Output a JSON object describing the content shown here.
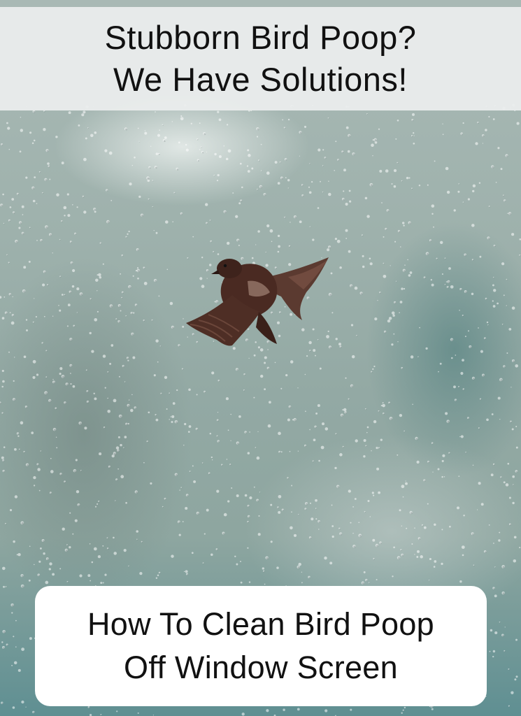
{
  "header": {
    "title_line_1": "Stubborn Bird Poop?",
    "title_line_2": "We Have Solutions!"
  },
  "footer": {
    "subtitle_line_1": "How To Clean Bird Poop",
    "subtitle_line_2": "Off Window Screen"
  },
  "image": {
    "subject": "bird-flying-behind-rainy-window",
    "colors": {
      "banner": "#eceeee",
      "card": "#ffffff",
      "text": "#111111",
      "bird": "#4a2a22"
    }
  }
}
